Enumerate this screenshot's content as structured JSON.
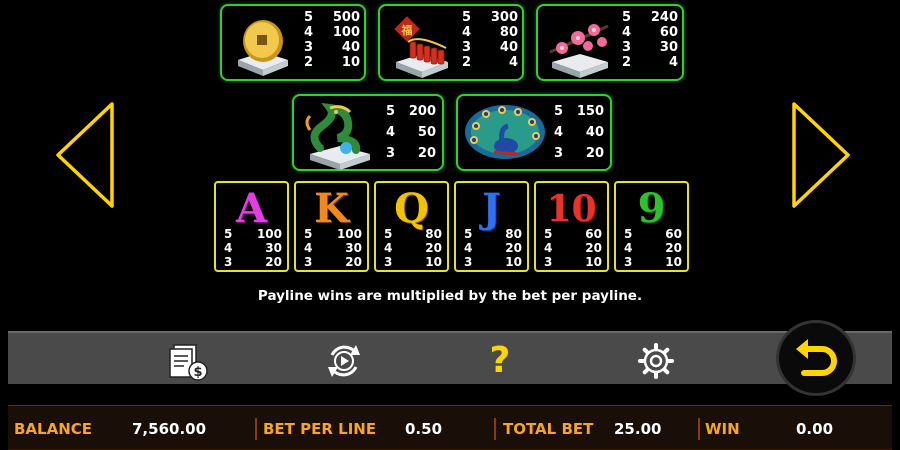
{
  "paytable": {
    "top": [
      {
        "symbol": "gold-coin",
        "pays": [
          [
            "5",
            "500"
          ],
          [
            "4",
            "100"
          ],
          [
            "3",
            "40"
          ],
          [
            "2",
            "10"
          ]
        ]
      },
      {
        "symbol": "firecracker",
        "pays": [
          [
            "5",
            "300"
          ],
          [
            "4",
            "80"
          ],
          [
            "3",
            "40"
          ],
          [
            "2",
            "4"
          ]
        ]
      },
      {
        "symbol": "plum-blossom",
        "pays": [
          [
            "5",
            "240"
          ],
          [
            "4",
            "60"
          ],
          [
            "3",
            "30"
          ],
          [
            "2",
            "4"
          ]
        ]
      }
    ],
    "middle": [
      {
        "symbol": "dragon",
        "pays": [
          [
            "5",
            "200"
          ],
          [
            "4",
            "50"
          ],
          [
            "3",
            "20"
          ]
        ]
      },
      {
        "symbol": "peacock",
        "pays": [
          [
            "5",
            "150"
          ],
          [
            "4",
            "40"
          ],
          [
            "3",
            "20"
          ]
        ]
      }
    ],
    "cards": [
      {
        "letter": "A",
        "color": "#e040e0",
        "pays": [
          [
            "5",
            "100"
          ],
          [
            "4",
            "30"
          ],
          [
            "3",
            "20"
          ]
        ]
      },
      {
        "letter": "K",
        "color": "#f08a1e",
        "pays": [
          [
            "5",
            "100"
          ],
          [
            "4",
            "30"
          ],
          [
            "3",
            "20"
          ]
        ]
      },
      {
        "letter": "Q",
        "color": "#f2c200",
        "pays": [
          [
            "5",
            "80"
          ],
          [
            "4",
            "20"
          ],
          [
            "3",
            "10"
          ]
        ]
      },
      {
        "letter": "J",
        "color": "#2f6ff0",
        "pays": [
          [
            "5",
            "80"
          ],
          [
            "4",
            "20"
          ],
          [
            "3",
            "10"
          ]
        ]
      },
      {
        "letter": "10",
        "color": "#e8322a",
        "pays": [
          [
            "5",
            "60"
          ],
          [
            "4",
            "20"
          ],
          [
            "3",
            "10"
          ]
        ]
      },
      {
        "letter": "9",
        "color": "#2ec02e",
        "pays": [
          [
            "5",
            "60"
          ],
          [
            "4",
            "20"
          ],
          [
            "3",
            "10"
          ]
        ]
      }
    ],
    "note": "Payline wins are multiplied by the bet per payline."
  },
  "toolbar": {
    "icons": [
      "paytable-icon",
      "autoplay-icon",
      "help-icon",
      "settings-icon",
      "back-icon"
    ],
    "help_glyph": "?"
  },
  "status": {
    "balance_label": "BALANCE",
    "balance_value": "7,560.00",
    "bet_per_line_label": "BET PER LINE",
    "bet_per_line_value": "0.50",
    "total_bet_label": "TOTAL BET",
    "total_bet_value": "25.00",
    "win_label": "WIN",
    "win_value": "0.00"
  },
  "colors": {
    "accent": "#f5a623",
    "nav_arrow": "#ffd400",
    "green_frame": "#2fd02f",
    "yellow_frame": "#e6e22a"
  }
}
